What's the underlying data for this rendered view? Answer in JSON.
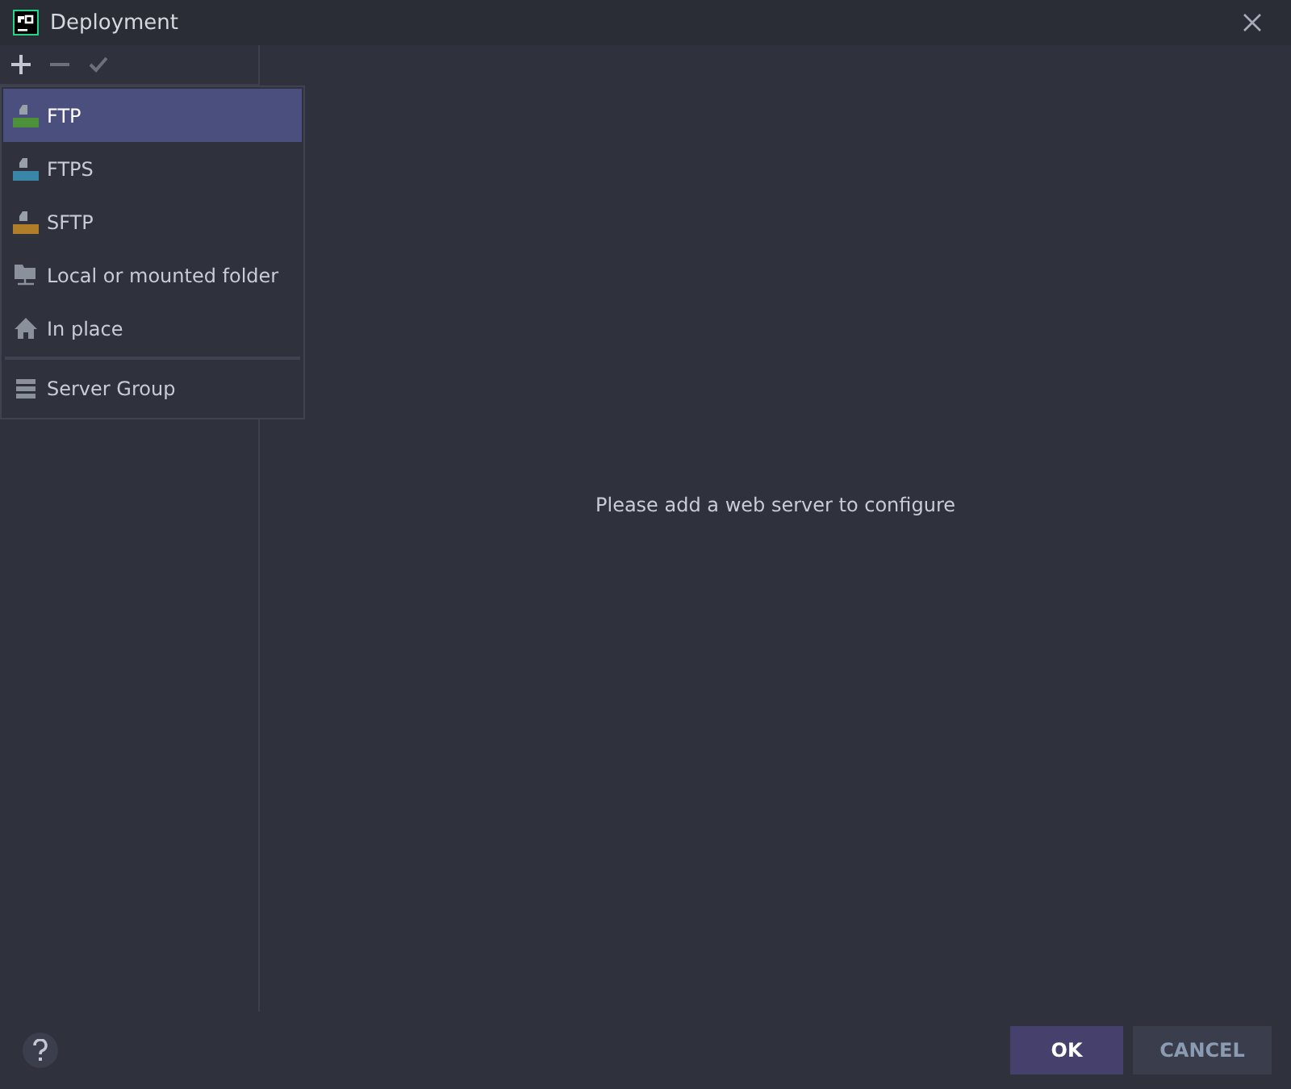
{
  "window": {
    "title": "Deployment"
  },
  "toolbar": [
    {
      "kind": "add",
      "disabled": false
    },
    {
      "kind": "remove",
      "disabled": true
    },
    {
      "kind": "check",
      "disabled": true
    }
  ],
  "menu": {
    "items": [
      {
        "kind": "ftp",
        "label": "FTP",
        "selected": true,
        "color": "#4e8f3a"
      },
      {
        "kind": "ftp",
        "label": "FTPS",
        "selected": false,
        "color": "#3a86a8"
      },
      {
        "kind": "ftp",
        "label": "SFTP",
        "selected": false,
        "color": "#b07d28"
      },
      {
        "kind": "folder",
        "label": "Local or mounted folder",
        "selected": false
      },
      {
        "kind": "home",
        "label": "In place",
        "selected": false
      },
      {
        "kind": "separator"
      },
      {
        "kind": "group",
        "label": "Server Group",
        "selected": false
      }
    ]
  },
  "message": "Please add a web server to configure",
  "buttons": [
    {
      "label": "OK",
      "primary": true
    },
    {
      "label": "CANCEL",
      "primary": false
    }
  ]
}
